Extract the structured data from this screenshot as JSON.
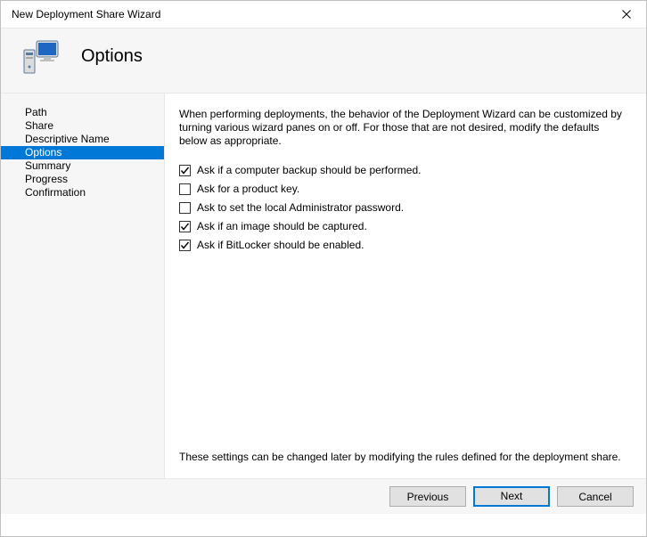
{
  "window": {
    "title": "New Deployment Share Wizard"
  },
  "header": {
    "title": "Options"
  },
  "sidebar": {
    "items": [
      {
        "label": "Path",
        "selected": false
      },
      {
        "label": "Share",
        "selected": false
      },
      {
        "label": "Descriptive Name",
        "selected": false
      },
      {
        "label": "Options",
        "selected": true
      },
      {
        "label": "Summary",
        "selected": false
      },
      {
        "label": "Progress",
        "selected": false
      },
      {
        "label": "Confirmation",
        "selected": false
      }
    ]
  },
  "main": {
    "intro": "When performing deployments, the behavior of the Deployment Wizard can be customized by turning various wizard panes on or off.  For those that are not desired, modify the defaults below as appropriate.",
    "options": [
      {
        "label": "Ask if a computer backup should be performed.",
        "checked": true
      },
      {
        "label": "Ask for a product key.",
        "checked": false
      },
      {
        "label": "Ask to set the local Administrator password.",
        "checked": false
      },
      {
        "label": "Ask if an image should be captured.",
        "checked": true
      },
      {
        "label": "Ask if BitLocker should be enabled.",
        "checked": true
      }
    ],
    "footnote": "These settings can be changed later by modifying the rules defined for the deployment share."
  },
  "buttons": {
    "previous": "Previous",
    "next": "Next",
    "cancel": "Cancel"
  }
}
